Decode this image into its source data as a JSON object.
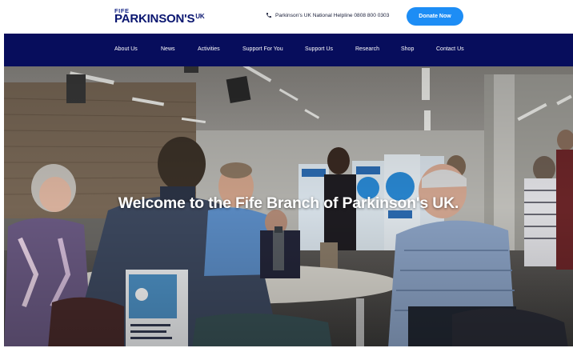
{
  "header": {
    "logo_small": "FIFE",
    "logo_main": "PARKINSON'S",
    "logo_sup": "UK",
    "helpline_text": "Parkinson's UK National Helpline 0808 800 0303",
    "phone_icon": "phone-icon",
    "donate_label": "Donate Now"
  },
  "nav": {
    "items": [
      {
        "label": "About Us"
      },
      {
        "label": "News"
      },
      {
        "label": "Activities"
      },
      {
        "label": "Support For You"
      },
      {
        "label": "Support Us"
      },
      {
        "label": "Research"
      },
      {
        "label": "Shop"
      },
      {
        "label": "Contact Us"
      }
    ]
  },
  "hero": {
    "title": "Welcome to the Fife Branch of Parkinson's UK."
  },
  "colors": {
    "brand_navy": "#070d5c",
    "donate_blue": "#1d8df5",
    "logo_navy": "#0a1670"
  }
}
